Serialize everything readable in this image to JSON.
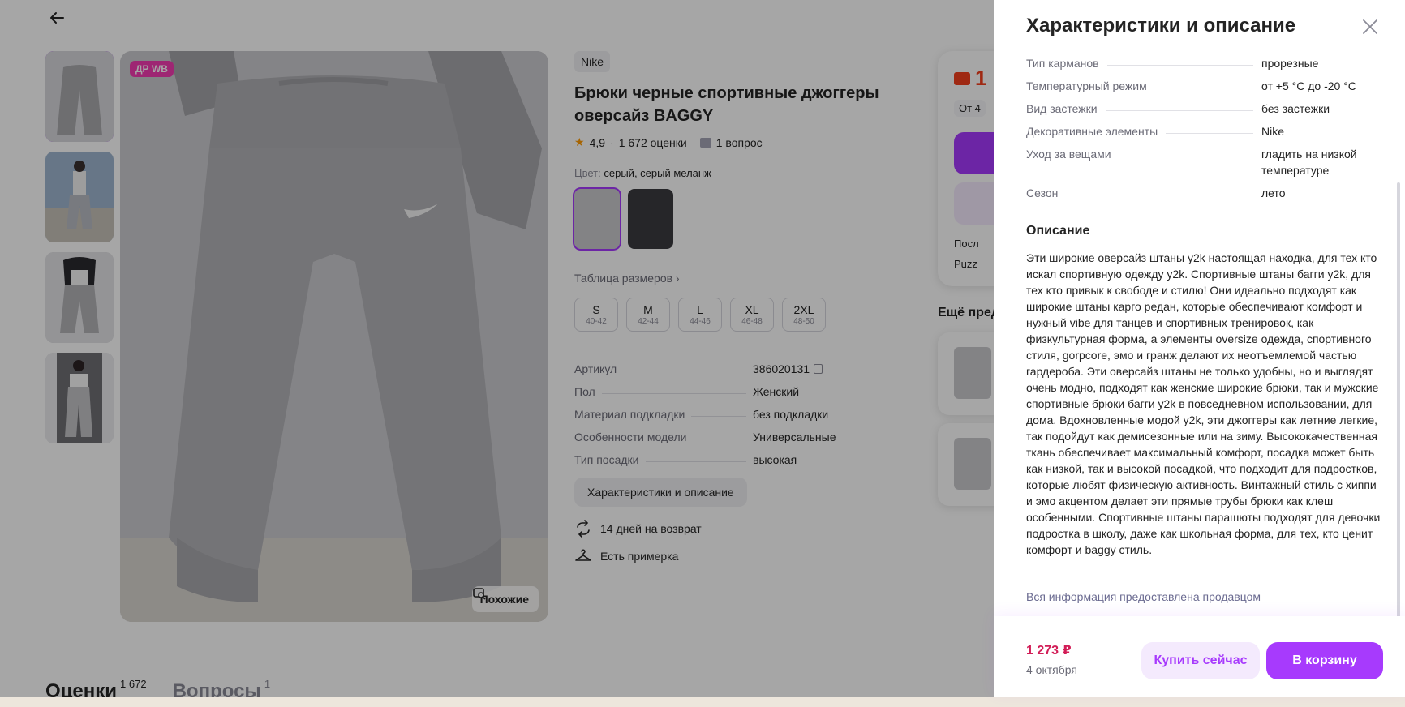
{
  "product": {
    "badge": "ДР WB",
    "similar_label": "Похожие",
    "brand": "Nike",
    "title": "Брюки черные спортивные джоггеры оверсайз BAGGY",
    "rating": "4,9",
    "reviews_count": "1 672 оценки",
    "questions_count": "1 вопрос",
    "color_label": "Цвет:",
    "color_value": "серый, серый меланж",
    "size_table_link": "Таблица размеров",
    "sizes": [
      {
        "size": "S",
        "range": "40-42"
      },
      {
        "size": "M",
        "range": "42-44"
      },
      {
        "size": "L",
        "range": "44-46"
      },
      {
        "size": "XL",
        "range": "46-48"
      },
      {
        "size": "2XL",
        "range": "48-50"
      }
    ],
    "params": [
      {
        "key": "Артикул",
        "value": "386020131"
      },
      {
        "key": "Пол",
        "value": "Женский"
      },
      {
        "key": "Материал подкладки",
        "value": "без подкладки"
      },
      {
        "key": "Особенности модели",
        "value": "Универсальные"
      },
      {
        "key": "Тип посадки",
        "value": "высокая"
      }
    ],
    "chars_button": "Характеристики и описание",
    "features": [
      "14 дней на возврат",
      "Есть примерка"
    ]
  },
  "buy_card": {
    "price_fragment": "1",
    "ot_fragment": "От 4",
    "line1": "Посл",
    "line2": "Puzz"
  },
  "more": {
    "title": "Ещё пред"
  },
  "tabs": [
    {
      "label": "Оценки",
      "count": "1 672"
    },
    {
      "label": "Вопросы",
      "count": "1"
    }
  ],
  "panel": {
    "title": "Характеристики и описание",
    "characteristics": [
      {
        "key": "Тип карманов",
        "value": "прорезные"
      },
      {
        "key": "Температурный режим",
        "value": "от +5 °С до -20 °С"
      },
      {
        "key": "Вид застежки",
        "value": "без застежки"
      },
      {
        "key": "Декоративные элементы",
        "value": "Nike"
      },
      {
        "key": "Уход за вещами",
        "value": "гладить на низкой температуре"
      },
      {
        "key": "Сезон",
        "value": "лето"
      }
    ],
    "description_title": "Описание",
    "description": "Эти широкие оверсайз штаны y2k настоящая находка, для тех кто искал спортивную одежду y2k. Спортивные штаны багги y2k, для тех кто привык к свободе и стилю! Они идеально подходят как широкие штаны карго редан, которые обеспечивают комфорт и нужный vibe для танцев и спортивных тренировок, как физкультурная форма, а элементы oversize одежда, спортивного стиля, gorpcore, эмо и гранж делают их неотъемлемой частью гардероба. Эти оверсайз штаны не только удобны, но и выглядят очень модно, подходят как женские широкие брюки, так и мужские спортивные брюки багги y2k в повседневном использовании, для дома. Вдохновленные модой y2k, эти джоггеры как летние легкие, так подойдут как демисезонные или на зиму. Высококачественная ткань обеспечивает максимальный комфорт, посадка может быть как низкой, так и высокой посадкой, что подходит для подростков, которые любят физическую активность. Винтажный стиль с хиппи и эмо акцентом делает эти прямые трубы брюки как клеш особенными. Спортивные штаны парашюты подходят для девочки подростка в школу, даже как школьная форма, для тех, кто ценит комфорт и baggy стиль.",
    "seller_note": "Вся информация предоставлена продавцом",
    "price": "1 273 ₽",
    "delivery_date": "4 октября",
    "buy_now": "Купить сейчас",
    "to_cart": "В корзину"
  },
  "colors": {
    "accent": "#a73afd",
    "price": "#d21d57",
    "badge": "#f33bb1"
  },
  "icons": [
    "arrow-left-icon",
    "close-icon",
    "star-icon",
    "copy-icon",
    "return-icon",
    "hanger-icon",
    "search-similar-icon"
  ]
}
